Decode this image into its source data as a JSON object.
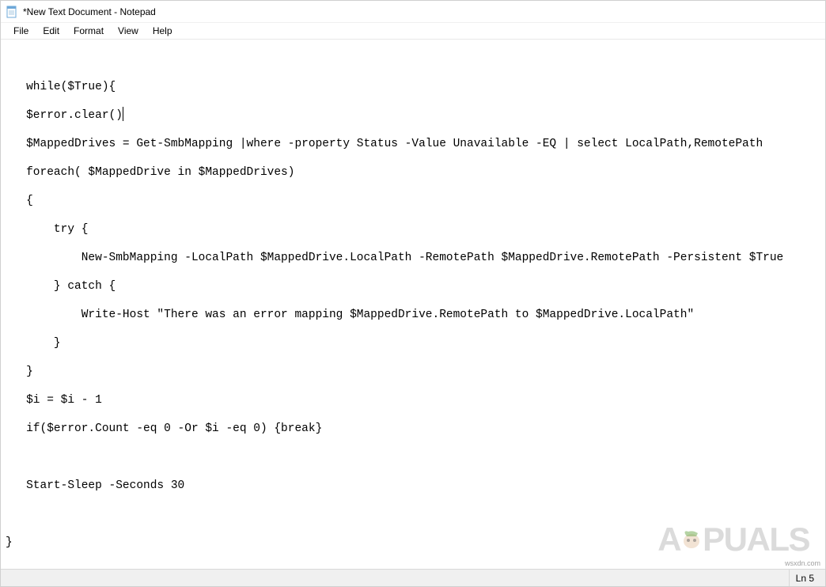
{
  "titlebar": {
    "title": "*New Text Document - Notepad"
  },
  "menubar": {
    "items": [
      {
        "label": "File"
      },
      {
        "label": "Edit"
      },
      {
        "label": "Format"
      },
      {
        "label": "View"
      },
      {
        "label": "Help"
      }
    ]
  },
  "editor": {
    "line1": "   while($True){",
    "line2_before_caret": "   $error.clear()",
    "line3": "   $MappedDrives = Get-SmbMapping |where -property Status -Value Unavailable -EQ | select LocalPath,RemotePath",
    "line4": "   foreach( $MappedDrive in $MappedDrives)",
    "line5": "   {",
    "line6": "       try {",
    "line7": "           New-SmbMapping -LocalPath $MappedDrive.LocalPath -RemotePath $MappedDrive.RemotePath -Persistent $True",
    "line8": "       } catch {",
    "line9": "           Write-Host \"There was an error mapping $MappedDrive.RemotePath to $MappedDrive.LocalPath\"",
    "line10": "       }",
    "line11": "   }",
    "line12": "   $i = $i - 1",
    "line13": "   if($error.Count -eq 0 -Or $i -eq 0) {break}",
    "line14": "",
    "line15": "   Start-Sleep -Seconds 30",
    "line16": "",
    "line17": "}"
  },
  "statusbar": {
    "position": "Ln 5"
  },
  "watermark": {
    "prefix": "A",
    "suffix": "PUALS"
  },
  "source_url": "wsxdn.com"
}
